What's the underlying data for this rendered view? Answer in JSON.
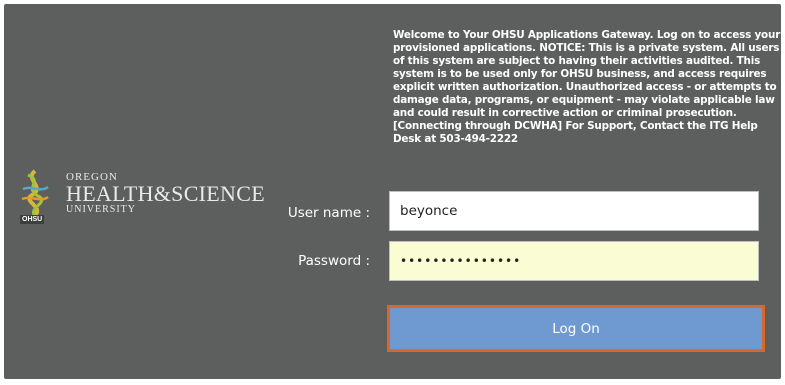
{
  "logo": {
    "line1": "OREGON",
    "line2": "HEALTH&SCIENCE",
    "line3": "UNIVERSITY",
    "tag": "OHSU"
  },
  "notice": "Welcome to Your OHSU Applications Gateway. Log on to access your provisioned applications. NOTICE: This is a private system. All users of this system are subject to having their activities audited. This system is to be used only for OHSU business, and access requires explicit written authorization. Unauthorized access - or attempts to damage data, programs, or equipment - may violate applicable law and could result in corrective action or criminal prosecution. [Connecting through DCWHA] For Support, Contact the ITG Help Desk at 503-494-2222",
  "form": {
    "username_label": "User name :",
    "username_value": "beyonce",
    "password_label": "Password :",
    "password_value": "•••••••••••••••",
    "submit_label": "Log On"
  },
  "colors": {
    "panel_bg": "#5d5e5e",
    "button_bg": "#6f9ad1",
    "button_border": "#d7682c",
    "password_bg": "#fafcd4"
  },
  "icons": {
    "logo": "ohsu-caduceus-logo-icon"
  }
}
